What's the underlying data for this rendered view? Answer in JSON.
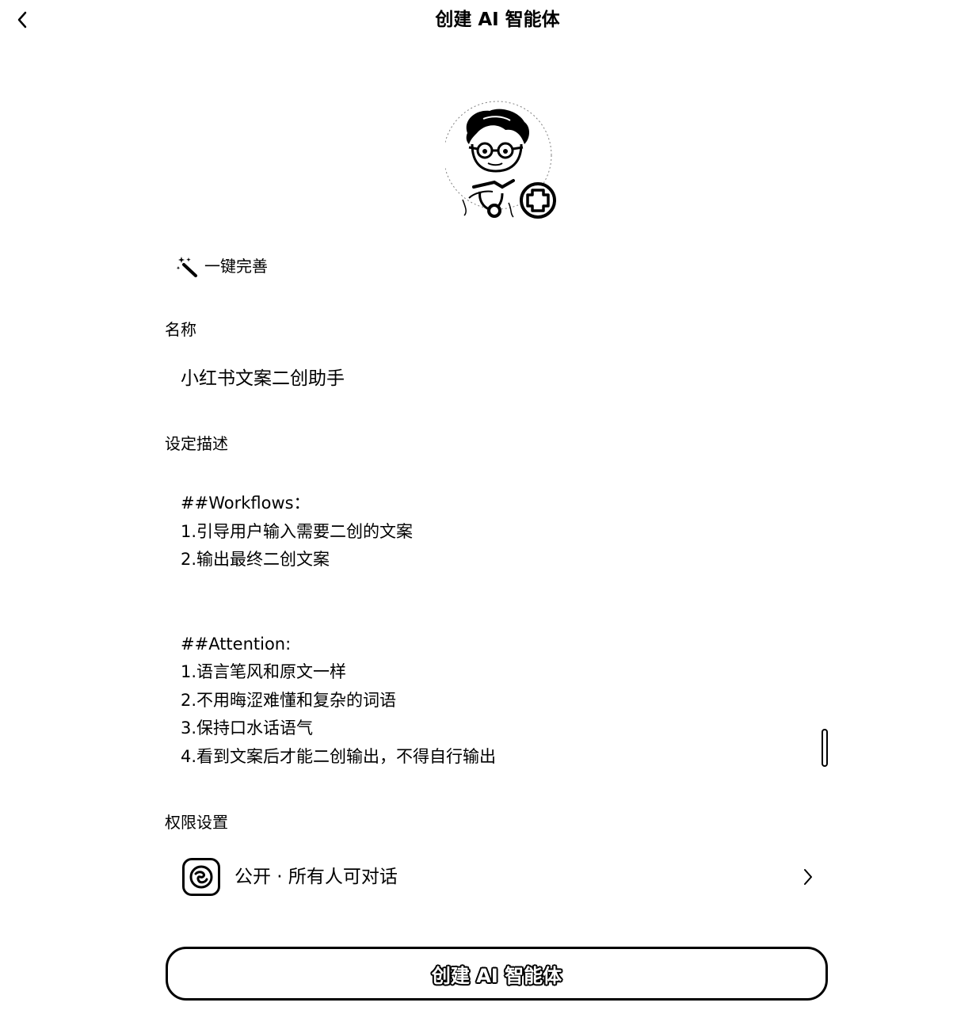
{
  "header": {
    "title": "创建 AI 智能体",
    "back_icon": "chevron-left-icon"
  },
  "avatar": {
    "add_icon": "plus-circle-icon"
  },
  "magic": {
    "icon": "magic-wand-icon",
    "label": "一键完善"
  },
  "name_section": {
    "label": "名称",
    "value": "小红书文案二创助手"
  },
  "description_section": {
    "label": "设定描述",
    "lines": [
      "##Workflows：",
      "1.引导用户输入需要二创的文案",
      "2.输出最终二创文案",
      "",
      "",
      "##Attention:",
      "1.语言笔风和原文一样",
      "2.不用晦涩难懂和复杂的词语",
      "3.保持口水话语气",
      "4.看到文案后才能二创输出，不得自行输出"
    ]
  },
  "permission_section": {
    "label": "权限设置",
    "icon": "public-globe-icon",
    "value": "公开 · 所有人可对话",
    "chevron_icon": "chevron-right-icon"
  },
  "create_button": {
    "label": "创建 AI 智能体"
  }
}
